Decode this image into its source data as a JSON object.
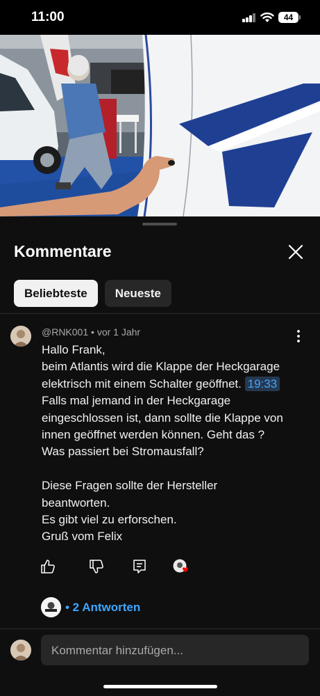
{
  "status_bar": {
    "time": "11:00",
    "battery": "44",
    "icons": [
      "signal-icon",
      "wifi-icon",
      "battery-icon"
    ]
  },
  "video": {
    "scene": "video-player-frame"
  },
  "sheet": {
    "title": "Kommentare",
    "close_icon": "close-icon",
    "tabs": [
      {
        "label": "Beliebteste",
        "active": true
      },
      {
        "label": "Neueste",
        "active": false
      }
    ]
  },
  "comment": {
    "author": "@RNK001",
    "separator": "•",
    "age": "vor 1 Jahr",
    "more_icon": "more-vertical-icon",
    "lines": {
      "l1": "Hallo Frank,",
      "l2": "beim Atlantis wird die Klappe der Heckgarage",
      "l3": "elektrisch mit einem Schalter geöffnet.",
      "timestamp": "19:33",
      "l4": "Falls mal jemand in der Heckgarage",
      "l5": "eingeschlossen ist, dann sollte die Klappe von",
      "l6": "innen geöffnet werden können. Geht das ?",
      "l7": "Was passiert bei Stromausfall?",
      "l8": "Diese Fragen sollte der Hersteller",
      "l9": "beantworten.",
      "l10": "Es gibt viel zu erforschen.",
      "l11": "Gruß vom Felix"
    },
    "actions": [
      "like-icon",
      "dislike-icon",
      "reply-icon",
      "creator-heart-icon"
    ],
    "replies_label": "• 2 Antworten"
  },
  "composer": {
    "placeholder": "Kommentar hinzufügen..."
  },
  "colors": {
    "background": "#0f0f0f",
    "chip_active": "#f1f1f1",
    "chip_inactive": "#272727",
    "link": "#3ea6ff",
    "timestamp_bg": "#263850",
    "heart": "#ff0000"
  }
}
